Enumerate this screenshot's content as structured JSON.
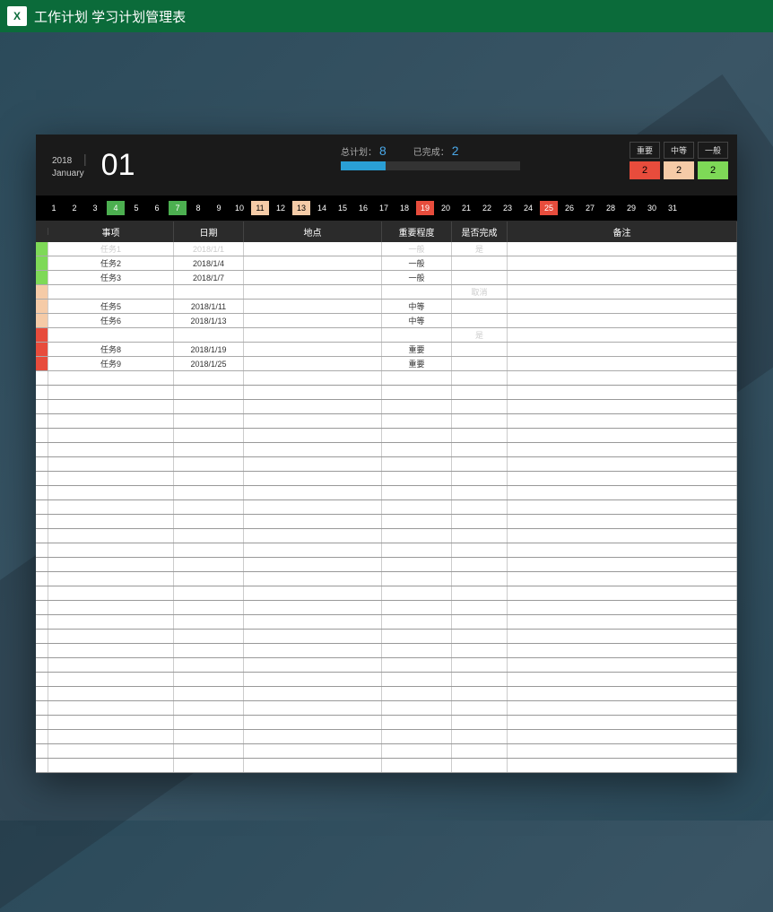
{
  "titlebar": {
    "text": "工作计划 学习计划管理表",
    "icon_label": "X"
  },
  "header": {
    "year": "2018",
    "month_name": "January",
    "month_number": "01",
    "total_plan_label": "总计划：",
    "total_plan_value": "8",
    "completed_label": "已完成：",
    "completed_value": "2",
    "progress_pct": 25
  },
  "legend": {
    "important": {
      "label": "重要",
      "count": "2",
      "color": "c-red"
    },
    "medium": {
      "label": "中等",
      "count": "2",
      "color": "c-peach"
    },
    "normal": {
      "label": "一般",
      "count": "2",
      "color": "c-green"
    }
  },
  "days": [
    {
      "n": "1"
    },
    {
      "n": "2"
    },
    {
      "n": "3"
    },
    {
      "n": "4",
      "cls": "day-green"
    },
    {
      "n": "5"
    },
    {
      "n": "6"
    },
    {
      "n": "7",
      "cls": "day-green"
    },
    {
      "n": "8"
    },
    {
      "n": "9"
    },
    {
      "n": "10"
    },
    {
      "n": "11",
      "cls": "day-peach"
    },
    {
      "n": "12"
    },
    {
      "n": "13",
      "cls": "day-peach"
    },
    {
      "n": "14"
    },
    {
      "n": "15"
    },
    {
      "n": "16"
    },
    {
      "n": "17"
    },
    {
      "n": "18"
    },
    {
      "n": "19",
      "cls": "day-red"
    },
    {
      "n": "20"
    },
    {
      "n": "21"
    },
    {
      "n": "22"
    },
    {
      "n": "23"
    },
    {
      "n": "24"
    },
    {
      "n": "25",
      "cls": "day-red"
    },
    {
      "n": "26"
    },
    {
      "n": "27"
    },
    {
      "n": "28"
    },
    {
      "n": "29"
    },
    {
      "n": "30"
    },
    {
      "n": "31"
    }
  ],
  "columns": {
    "item": "事项",
    "date": "日期",
    "place": "地点",
    "importance": "重要程度",
    "done": "是否完成",
    "note": "备注"
  },
  "rows": [
    {
      "swatch": "c-green",
      "item": "任务1",
      "date": "2018/1/1",
      "place": "",
      "imp": "一般",
      "done": "是",
      "note": "",
      "faded": true
    },
    {
      "swatch": "c-green",
      "item": "任务2",
      "date": "2018/1/4",
      "place": "",
      "imp": "一般",
      "done": "",
      "note": ""
    },
    {
      "swatch": "c-green",
      "item": "任务3",
      "date": "2018/1/7",
      "place": "",
      "imp": "一般",
      "done": "",
      "note": ""
    },
    {
      "swatch": "c-peach",
      "item": "",
      "date": "",
      "place": "",
      "imp": "",
      "done": "取消",
      "note": "",
      "faded": true
    },
    {
      "swatch": "c-peach",
      "item": "任务5",
      "date": "2018/1/11",
      "place": "",
      "imp": "中等",
      "done": "",
      "note": ""
    },
    {
      "swatch": "c-peach",
      "item": "任务6",
      "date": "2018/1/13",
      "place": "",
      "imp": "中等",
      "done": "",
      "note": ""
    },
    {
      "swatch": "c-red",
      "item": "",
      "date": "",
      "place": "",
      "imp": "",
      "done": "是",
      "note": "",
      "faded": true
    },
    {
      "swatch": "c-red",
      "item": "任务8",
      "date": "2018/1/19",
      "place": "",
      "imp": "重要",
      "done": "",
      "note": ""
    },
    {
      "swatch": "c-red",
      "item": "任务9",
      "date": "2018/1/25",
      "place": "",
      "imp": "重要",
      "done": "",
      "note": ""
    }
  ],
  "empty_row_count": 28
}
